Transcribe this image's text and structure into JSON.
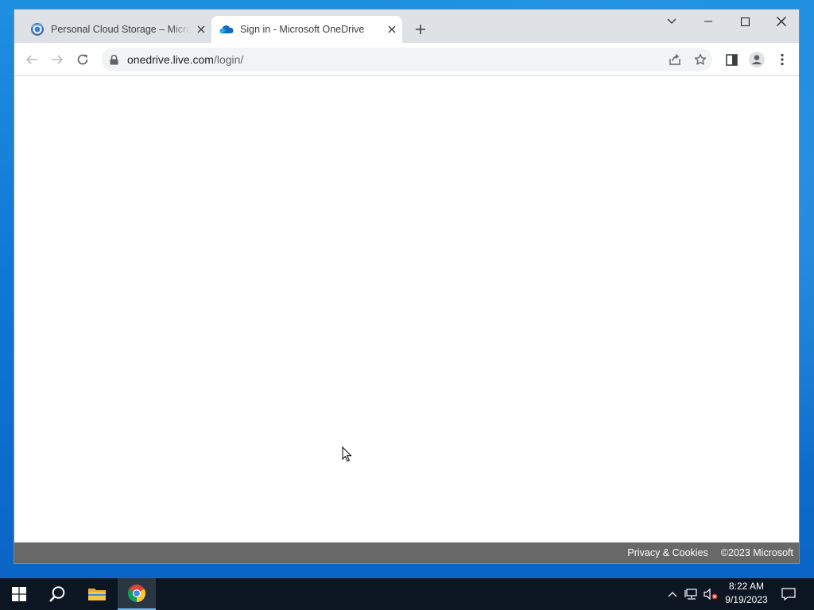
{
  "browser": {
    "tabs": [
      {
        "title": "Personal Cloud Storage – Microsoft OneDrive",
        "favicon": "edge-like-icon",
        "active": false
      },
      {
        "title": "Sign in - Microsoft OneDrive",
        "favicon": "onedrive-cloud-icon",
        "active": true
      }
    ],
    "address_bar": {
      "host": "onedrive.live.com",
      "path": "/login/"
    }
  },
  "page": {
    "footer": {
      "privacy_link": "Privacy & Cookies",
      "copyright": "©2023 Microsoft"
    }
  },
  "taskbar": {
    "clock_time": "8:22 AM",
    "clock_date": "9/19/2023"
  },
  "colors": {
    "footer_bg": "#686868",
    "taskbar_bg": "#0b1622",
    "desktop_bg": "#0f78d6",
    "onedrive_blue": "#0f6cbd"
  }
}
